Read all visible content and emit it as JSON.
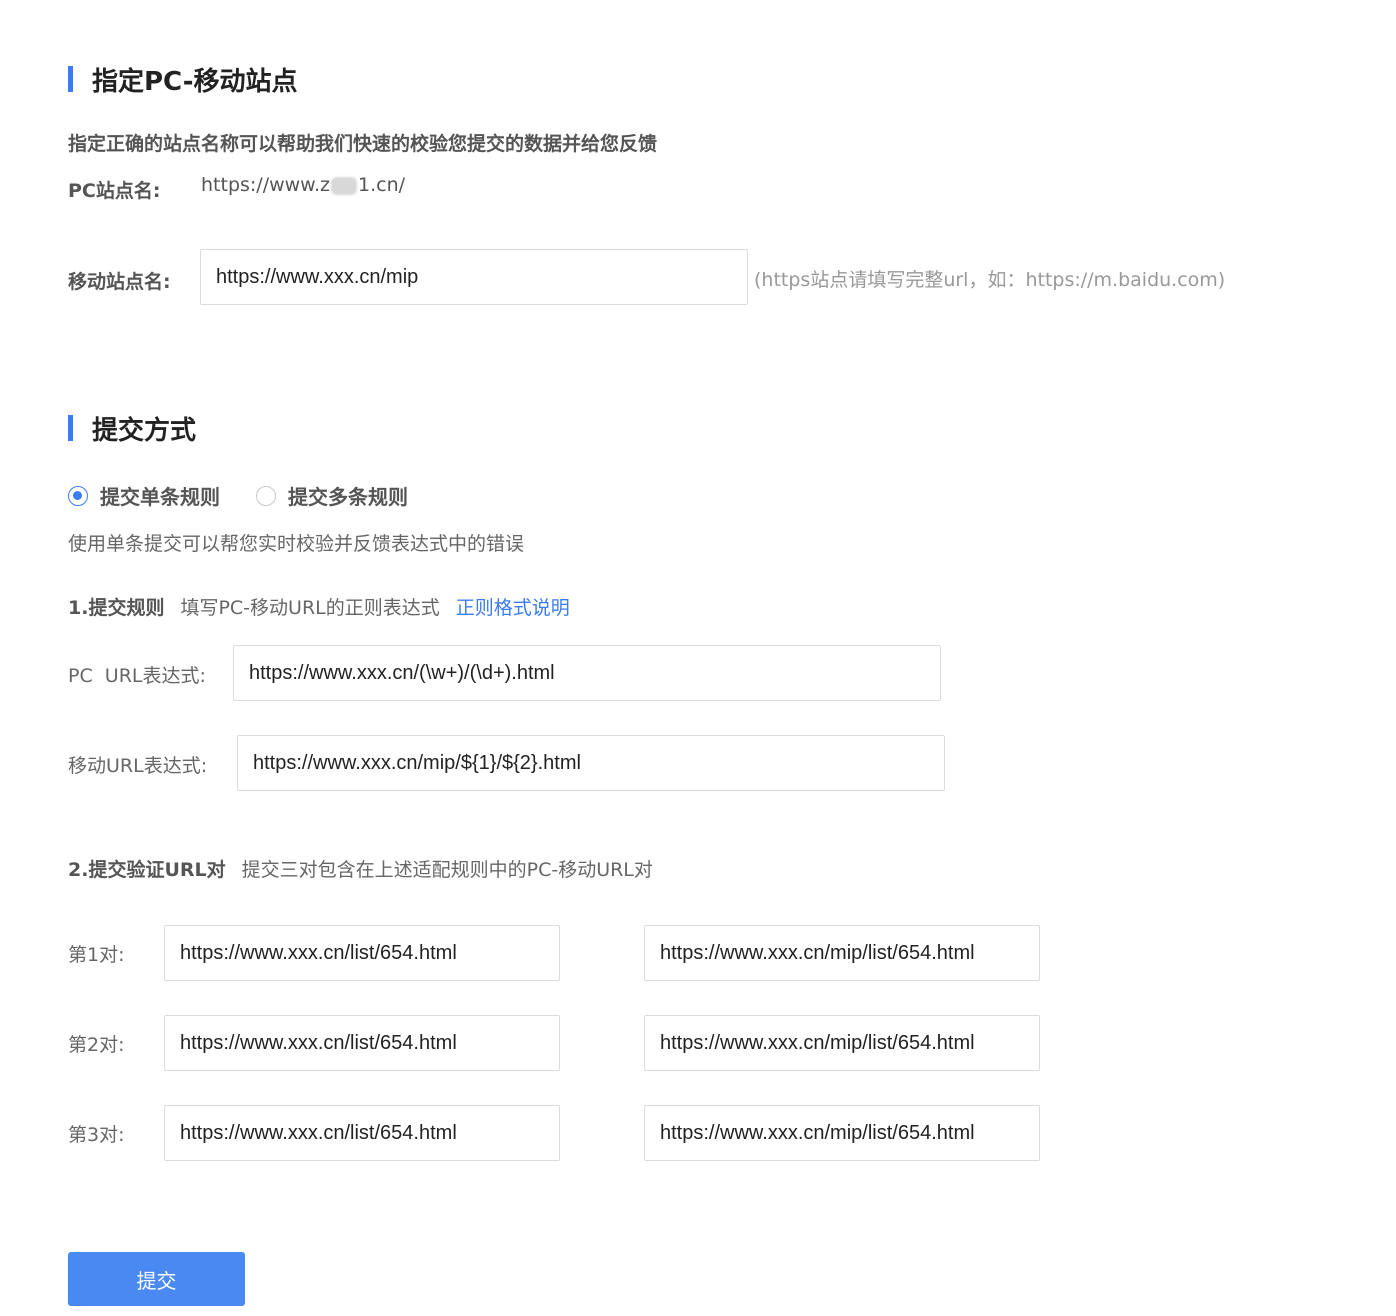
{
  "site_section": {
    "title": "指定PC-移动站点",
    "description": "指定正确的站点名称可以帮助我们快速的校验您提交的数据并给您反馈",
    "pc_site_label": "PC站点名:",
    "pc_site_value_prefix": "https://www.z",
    "pc_site_value_suffix": "1.cn/",
    "mobile_site_label": "移动站点名:",
    "mobile_site_value": "https://www.xxx.cn/mip",
    "mobile_site_hint": "(https站点请填写完整url，如：https://m.baidu.com)"
  },
  "submit_section": {
    "title": "提交方式",
    "radio_options": [
      {
        "label": "提交单条规则",
        "checked": true
      },
      {
        "label": "提交多条规则",
        "checked": false
      }
    ],
    "description": "使用单条提交可以帮您实时校验并反馈表达式中的错误",
    "step1": {
      "title": "1.提交规则",
      "desc": "填写PC-移动URL的正则表达式",
      "link": "正则格式说明",
      "pc_url_label": "PC  URL表达式:",
      "pc_url_value": "https://www.xxx.cn/(\\w+)/(\\d+).html",
      "mobile_url_label": "移动URL表达式:",
      "mobile_url_value": "https://www.xxx.cn/mip/${1}/${2}.html"
    },
    "step2": {
      "title": "2.提交验证URL对",
      "desc": "提交三对包含在上述适配规则中的PC-移动URL对",
      "pairs": [
        {
          "label": "第1对:",
          "pc": "https://www.xxx.cn/list/654.html",
          "mobile": "https://www.xxx.cn/mip/list/654.html"
        },
        {
          "label": "第2对:",
          "pc": "https://www.xxx.cn/list/654.html",
          "mobile": "https://www.xxx.cn/mip/list/654.html"
        },
        {
          "label": "第3对:",
          "pc": "https://www.xxx.cn/list/654.html",
          "mobile": "https://www.xxx.cn/mip/list/654.html"
        }
      ]
    },
    "submit_button": "提交"
  },
  "colors": {
    "accent": "#3b7cf0",
    "button": "#4a88f2"
  }
}
